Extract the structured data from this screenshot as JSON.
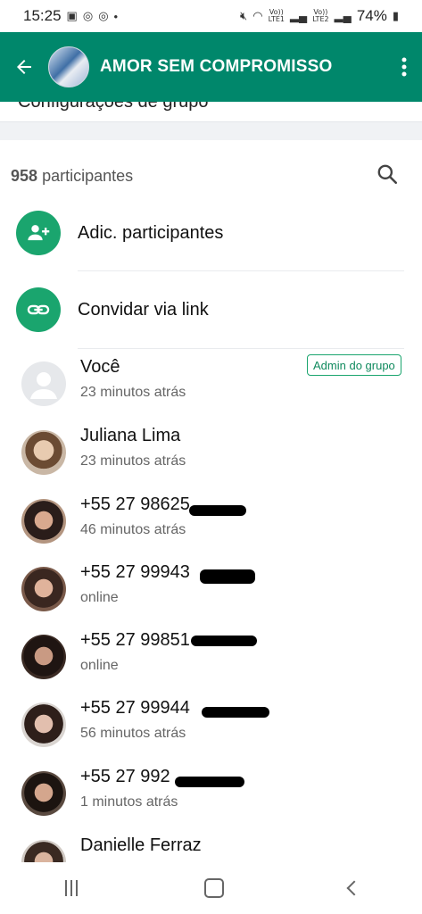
{
  "status_bar": {
    "time": "15:25",
    "battery": "74%",
    "sim1": "Vo))\nLTE1",
    "sim2": "Vo))\nLTE2"
  },
  "header": {
    "title": "AMOR SEM COMPROMISSO"
  },
  "cut_off_row": {
    "label": "Configurações de grupo"
  },
  "participants": {
    "count_number": "958",
    "count_label": "participantes"
  },
  "actions": [
    {
      "label": "Adic. participantes",
      "icon": "add-person-icon"
    },
    {
      "label": "Convidar via link",
      "icon": "link-icon"
    }
  ],
  "members": [
    {
      "name": "Você",
      "status": "23 minutos atrás",
      "badge": "Admin do grupo"
    },
    {
      "name": "Juliana Lima",
      "status": "23 minutos atrás"
    },
    {
      "name": "+55 27 98625",
      "status": "46 minutos atrás"
    },
    {
      "name": "+55 27 99943",
      "status": "online"
    },
    {
      "name": "+55 27 99851",
      "status": "online"
    },
    {
      "name": "+55 27 99944",
      "status": "56 minutos atrás"
    },
    {
      "name": "+55 27 992",
      "status": "1 minutos atrás"
    },
    {
      "name": "Danielle Ferraz",
      "status": ""
    }
  ],
  "colors": {
    "header": "#00876b",
    "accent": "#1aa56e"
  }
}
